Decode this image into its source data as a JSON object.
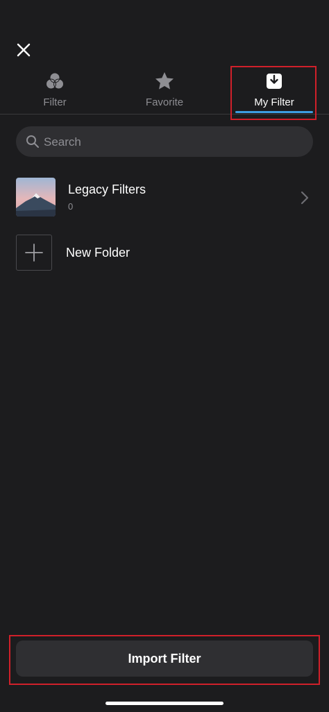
{
  "header": {
    "close_icon": "close-icon"
  },
  "tabs": [
    {
      "label": "Filter",
      "icon": "filter-circles-icon",
      "active": false
    },
    {
      "label": "Favorite",
      "icon": "star-icon",
      "active": false
    },
    {
      "label": "My Filter",
      "icon": "import-tray-icon",
      "active": true
    }
  ],
  "search": {
    "placeholder": "Search",
    "value": ""
  },
  "folders": [
    {
      "name": "Legacy Filters",
      "count": "0",
      "thumbnail": "mountain-thumbnail"
    }
  ],
  "new_folder": {
    "label": "New Folder"
  },
  "import_button": {
    "label": "Import Filter"
  },
  "colors": {
    "background": "#1c1c1e",
    "accent": "#3d9de0",
    "highlight": "#d0202a",
    "control": "#2f2f32"
  }
}
